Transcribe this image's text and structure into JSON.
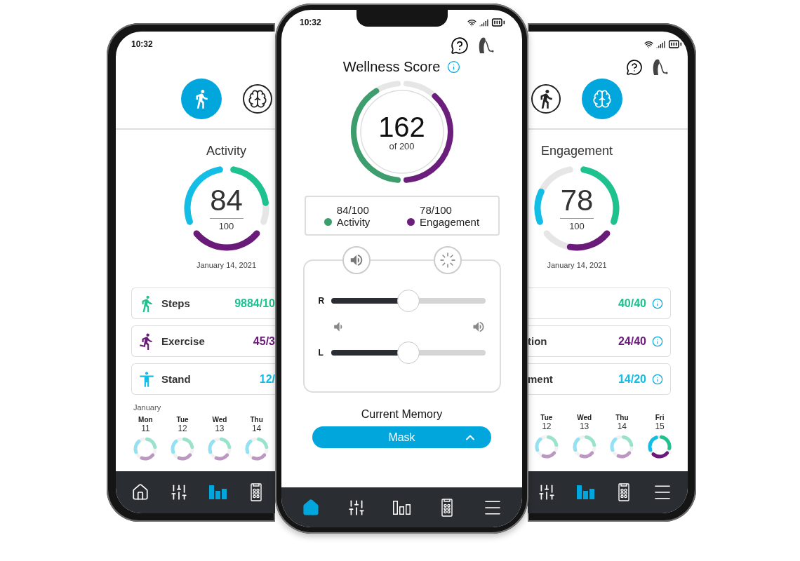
{
  "left_phone": {
    "time": "10:32",
    "tabs": [
      {
        "kind": "activity",
        "selected": true
      },
      {
        "kind": "engagement",
        "selected": false
      }
    ],
    "title": "Activity",
    "score": "84",
    "score_total": "100",
    "date": "January 14, 2021",
    "metrics": [
      {
        "kind": "steps",
        "label": "Steps",
        "value": "9884/10",
        "color": "#1ec28f"
      },
      {
        "kind": "exercise",
        "label": "Exercise",
        "value": "45/3",
        "color": "#6a1b7a"
      },
      {
        "kind": "stand",
        "label": "Stand",
        "value": "12/",
        "color": "#12bde6"
      }
    ],
    "month": "January",
    "days": [
      {
        "weekday": "Mon",
        "day": "11",
        "selected": false
      },
      {
        "weekday": "Tue",
        "day": "12",
        "selected": false
      },
      {
        "weekday": "Wed",
        "day": "13",
        "selected": false
      },
      {
        "weekday": "Thu",
        "day": "14",
        "selected": false
      }
    ],
    "nav": [
      {
        "kind": "home",
        "selected": false
      },
      {
        "kind": "sliders",
        "selected": false
      },
      {
        "kind": "bars",
        "selected": true
      },
      {
        "kind": "remote",
        "selected": false
      }
    ]
  },
  "center_phone": {
    "time": "10:32",
    "title": "Wellness Score",
    "score": "162",
    "score_caption": "of 200",
    "summary": [
      {
        "value": "84/100",
        "label": "Activity",
        "color": "#3d9d6c"
      },
      {
        "value": "78/100",
        "label": "Engagement",
        "color": "#6b1e7c"
      }
    ],
    "sliders": [
      {
        "label": "R",
        "level": 0.5
      },
      {
        "label": "L",
        "level": 0.5
      }
    ],
    "memory_label": "Current Memory",
    "memory_value": "Mask",
    "nav": [
      {
        "kind": "home",
        "selected": true
      },
      {
        "kind": "sliders",
        "selected": false
      },
      {
        "kind": "bars",
        "selected": false
      },
      {
        "kind": "remote",
        "selected": false
      },
      {
        "kind": "menu",
        "selected": false
      }
    ]
  },
  "right_phone": {
    "tabs": [
      {
        "kind": "activity",
        "selected": false
      },
      {
        "kind": "engagement",
        "selected": true
      }
    ],
    "title": "Engagement",
    "score": "78",
    "score_total": "100",
    "date": "January 14, 2021",
    "metrics": [
      {
        "value": "40/40",
        "color": "#1ec28f"
      },
      {
        "label": "tion",
        "value": "24/40",
        "color": "#6a1b7a"
      },
      {
        "label": "ment",
        "value": "14/20",
        "color": "#12bde6"
      }
    ],
    "days": [
      {
        "weekday": "Tue",
        "day": "12",
        "selected": false
      },
      {
        "weekday": "Wed",
        "day": "13",
        "selected": false
      },
      {
        "weekday": "Thu",
        "day": "14",
        "selected": false
      },
      {
        "weekday": "Fri",
        "day": "15",
        "selected": true
      }
    ],
    "nav": [
      {
        "kind": "sliders",
        "selected": false
      },
      {
        "kind": "bars",
        "selected": true
      },
      {
        "kind": "remote",
        "selected": false
      },
      {
        "kind": "menu",
        "selected": false
      }
    ]
  }
}
